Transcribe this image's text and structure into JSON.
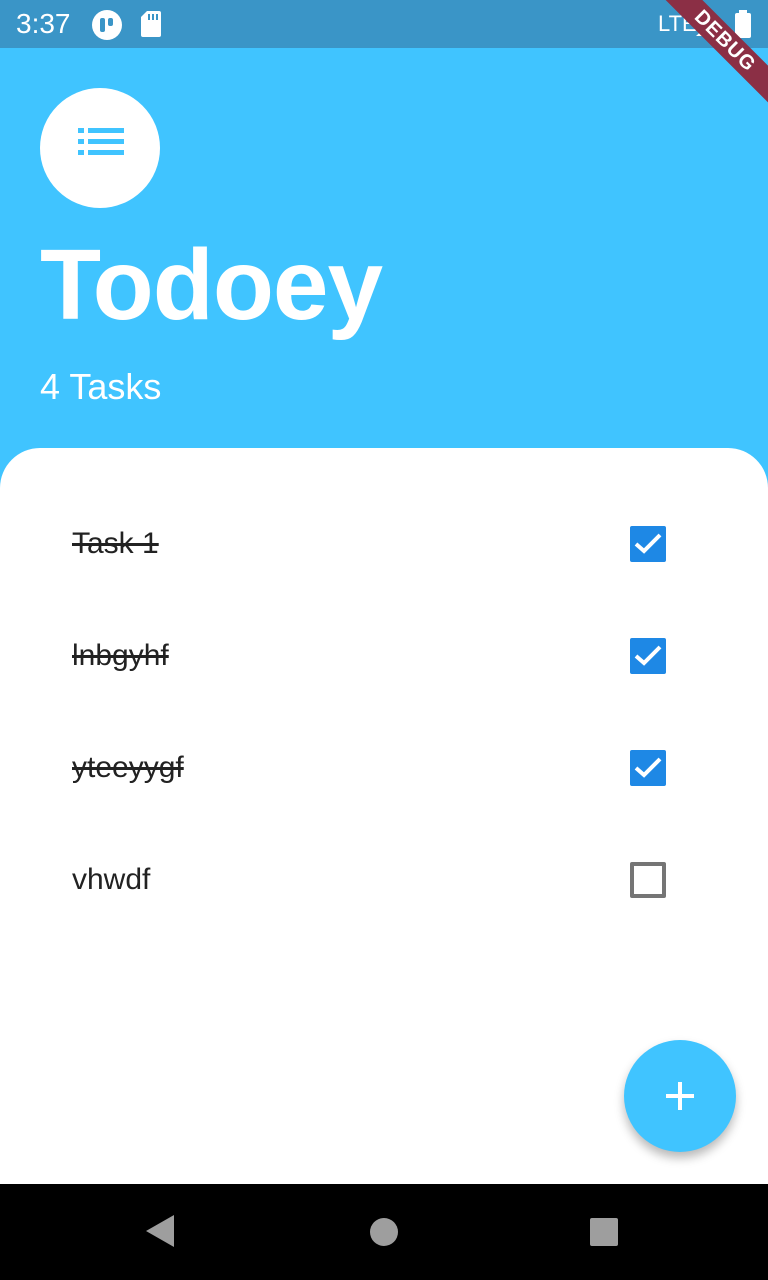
{
  "status_bar": {
    "time": "3:37",
    "network": "LTE",
    "icons": [
      "app-icon",
      "sd-card-icon",
      "signal-icon",
      "battery-icon"
    ]
  },
  "debug_banner": "DEBUG",
  "header": {
    "icon": "list-icon",
    "title": "Todoey",
    "task_count": "4 Tasks"
  },
  "tasks": [
    {
      "title": "Task 1",
      "done": true
    },
    {
      "title": "lnbgyhf",
      "done": true
    },
    {
      "title": "yteeyygf",
      "done": true
    },
    {
      "title": "vhwdf",
      "done": false
    }
  ],
  "fab": {
    "icon": "plus-icon"
  },
  "nav_bar": {
    "icons": [
      "back-icon",
      "home-icon",
      "recents-icon"
    ]
  },
  "colors": {
    "primary": "#40c4ff",
    "status_bar": "#3a95c7",
    "checkbox_checked": "#1e88e5",
    "checkbox_unchecked": "#757575",
    "debug_banner": "#8b2f45"
  }
}
